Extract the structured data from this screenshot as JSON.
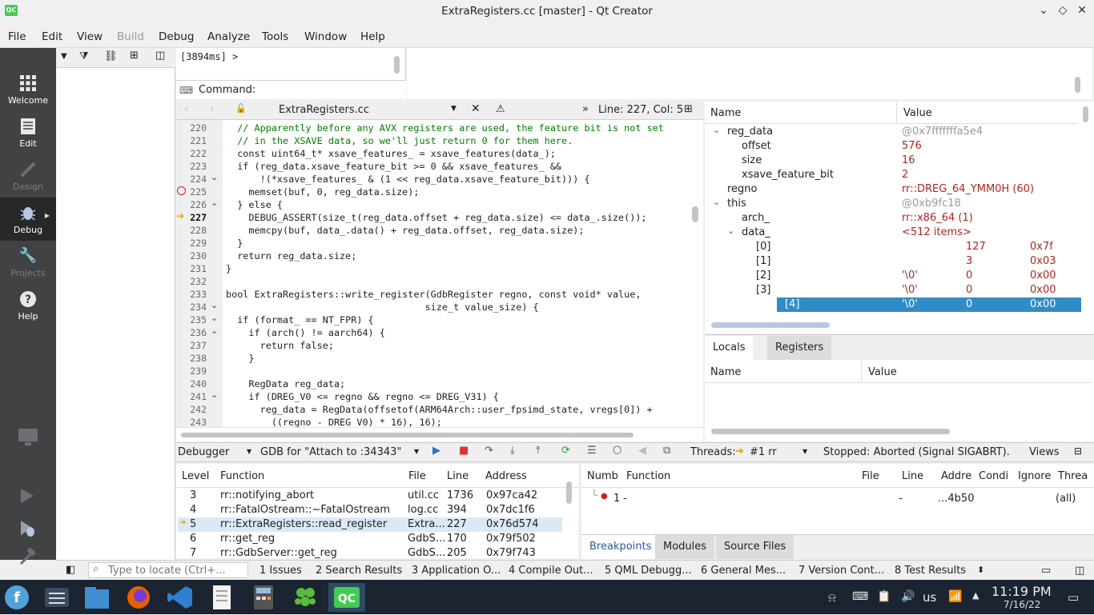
{
  "window": {
    "title": "ExtraRegisters.cc [master] - Qt Creator",
    "logo": "QC"
  },
  "menu": [
    "File",
    "Edit",
    "View",
    "Build",
    "Debug",
    "Analyze",
    "Tools",
    "Window",
    "Help"
  ],
  "modes": [
    {
      "label": "Welcome",
      "icon": "grid-icon"
    },
    {
      "label": "Edit",
      "icon": "document-icon"
    },
    {
      "label": "Design",
      "icon": "pen-icon"
    },
    {
      "label": "Debug",
      "icon": "bug-icon"
    },
    {
      "label": "Projects",
      "icon": "wrench-icon"
    },
    {
      "label": "Help",
      "icon": "help-icon"
    }
  ],
  "console": {
    "line": "[3894ms] >",
    "command_label": "Command:"
  },
  "editor": {
    "filename": "ExtraRegisters.cc",
    "position": "Line: 227, Col: 5",
    "lines": [
      {
        "n": "220",
        "t": "  // Apparently before any AVX registers are used, the feature bit is not set",
        "k": "comment"
      },
      {
        "n": "221",
        "t": "  // in the XSAVE data, so we'll just return 0 for them here.",
        "k": "comment"
      },
      {
        "n": "222",
        "t": "  const uint64_t* xsave_features_ = xsave_features(data_);",
        "k": "code"
      },
      {
        "n": "223",
        "t": "  if (reg_data.xsave_feature_bit >= 0 && xsave_features_ &&",
        "k": "code"
      },
      {
        "n": "224",
        "t": "      !(*xsave_features_ & (1 << reg_data.xsave_feature_bit))) {",
        "k": "code"
      },
      {
        "n": "225",
        "t": "    memset(buf, 0, reg_data.size);",
        "k": "code"
      },
      {
        "n": "226",
        "t": "  } else {",
        "k": "code"
      },
      {
        "n": "227",
        "t": "    DEBUG_ASSERT(size_t(reg_data.offset + reg_data.size) <= data_.size());",
        "k": "code"
      },
      {
        "n": "228",
        "t": "    memcpy(buf, data_.data() + reg_data.offset, reg_data.size);",
        "k": "code"
      },
      {
        "n": "229",
        "t": "  }",
        "k": "code"
      },
      {
        "n": "230",
        "t": "  return reg_data.size;",
        "k": "code"
      },
      {
        "n": "231",
        "t": "}",
        "k": "code"
      },
      {
        "n": "232",
        "t": "",
        "k": "code"
      },
      {
        "n": "233",
        "t": "bool ExtraRegisters::write_register(GdbRegister regno, const void* value,",
        "k": "code"
      },
      {
        "n": "234",
        "t": "                                   size_t value_size) {",
        "k": "code"
      },
      {
        "n": "235",
        "t": "  if (format_ == NT_FPR) {",
        "k": "code"
      },
      {
        "n": "236",
        "t": "    if (arch() != aarch64) {",
        "k": "code"
      },
      {
        "n": "237",
        "t": "      return false;",
        "k": "code"
      },
      {
        "n": "238",
        "t": "    }",
        "k": "code"
      },
      {
        "n": "239",
        "t": "",
        "k": "code"
      },
      {
        "n": "240",
        "t": "    RegData reg_data;",
        "k": "code"
      },
      {
        "n": "241",
        "t": "    if (DREG_V0 <= regno && regno <= DREG_V31) {",
        "k": "code"
      },
      {
        "n": "242",
        "t": "      reg_data = RegData(offsetof(ARM64Arch::user_fpsimd_state, vregs[0]) +",
        "k": "code"
      },
      {
        "n": "243",
        "t": "        ((regno - DREG_V0) * 16), 16);",
        "k": "code"
      }
    ]
  },
  "watch": {
    "headers": [
      "Name",
      "Value"
    ],
    "rows": [
      {
        "name": "reg_data",
        "value": "@0x7fffffffa5e4",
        "indent": 0,
        "exp": "v",
        "vc": "gray"
      },
      {
        "name": "offset",
        "value": "576",
        "indent": 1,
        "exp": "",
        "vc": "red"
      },
      {
        "name": "size",
        "value": "16",
        "indent": 1,
        "exp": "",
        "vc": "red"
      },
      {
        "name": "xsave_feature_bit",
        "value": "2",
        "indent": 1,
        "exp": "",
        "vc": "red"
      },
      {
        "name": "regno",
        "value": "rr::DREG_64_YMM0H (60)",
        "indent": 0,
        "exp": "",
        "vc": "red"
      },
      {
        "name": "this",
        "value": "@0xb9fc18",
        "indent": 0,
        "exp": "v",
        "vc": "gray"
      },
      {
        "name": "arch_",
        "value": "rr::x86_64 (1)",
        "indent": 1,
        "exp": "",
        "vc": "red"
      },
      {
        "name": "data_",
        "value": "<512 items>",
        "indent": 1,
        "exp": "v",
        "vc": "red"
      },
      {
        "name": "[0]",
        "value": "",
        "dec": "127",
        "hex": "0x7f",
        "indent": 2,
        "exp": "",
        "vc": "red"
      },
      {
        "name": "[1]",
        "value": "",
        "dec": "3",
        "hex": "0x03",
        "indent": 2,
        "exp": "",
        "vc": "red"
      },
      {
        "name": "[2]",
        "value": "'\\0'",
        "dec": "0",
        "hex": "0x00",
        "indent": 2,
        "exp": "",
        "vc": "red"
      },
      {
        "name": "[3]",
        "value": "'\\0'",
        "dec": "0",
        "hex": "0x00",
        "indent": 2,
        "exp": "",
        "vc": "red"
      },
      {
        "name": "[4]",
        "value": "'\\0'",
        "dec": "0",
        "hex": "0x00",
        "indent": 2,
        "exp": "",
        "vc": "sel"
      }
    ]
  },
  "locals_tabs": [
    "Locals",
    "Registers"
  ],
  "locals_headers": [
    "Name",
    "Value"
  ],
  "debugger_bar": {
    "engine": "Debugger",
    "gdb": "GDB for \"Attach to :34343\"",
    "threads_label": "Threads:",
    "thread": "#1 rr",
    "status": "Stopped: Aborted (Signal SIGABRT).",
    "views": "Views"
  },
  "stack": {
    "headers": [
      "Level",
      "Function",
      "File",
      "Line",
      "Address"
    ],
    "rows": [
      {
        "level": "3",
        "function": "rr::notifying_abort",
        "file": "util.cc",
        "line": "1736",
        "address": "0x97ca42"
      },
      {
        "level": "4",
        "function": "rr::FatalOstream::~FatalOstream",
        "file": "log.cc",
        "line": "394",
        "address": "0x7dc1f6"
      },
      {
        "level": "5",
        "function": "rr::ExtraRegisters::read_register",
        "file": "Extra...",
        "line": "227",
        "address": "0x76d574"
      },
      {
        "level": "6",
        "function": "rr::get_reg",
        "file": "GdbS...",
        "line": "170",
        "address": "0x79f502"
      },
      {
        "level": "7",
        "function": "rr::GdbServer::get_reg",
        "file": "GdbS...",
        "line": "205",
        "address": "0x79f743"
      }
    ]
  },
  "breakpoints": {
    "headers": [
      "Numb",
      "Function",
      "File",
      "Line",
      "Addre",
      "Condi",
      "Ignore",
      "Threa"
    ],
    "rows": [
      {
        "num": "1",
        "function": "-",
        "file": "",
        "line": "-",
        "address": "...4b50",
        "condition": "",
        "ignore": "",
        "threads": "(all)"
      }
    ],
    "tabs": [
      "Breakpoints",
      "Modules",
      "Source Files"
    ]
  },
  "output_panes": {
    "locator_placeholder": "Type to locate (Ctrl+...",
    "items": [
      "1  Issues",
      "2  Search Results",
      "3  Application O...",
      "4  Compile Out...",
      "5  QML Debugg...",
      "6  General Mes...",
      "7  Version Cont...",
      "8  Test Results"
    ]
  },
  "taskbar": {
    "keyboard": "us",
    "time": "11:19 PM",
    "date": "7/16/22"
  }
}
